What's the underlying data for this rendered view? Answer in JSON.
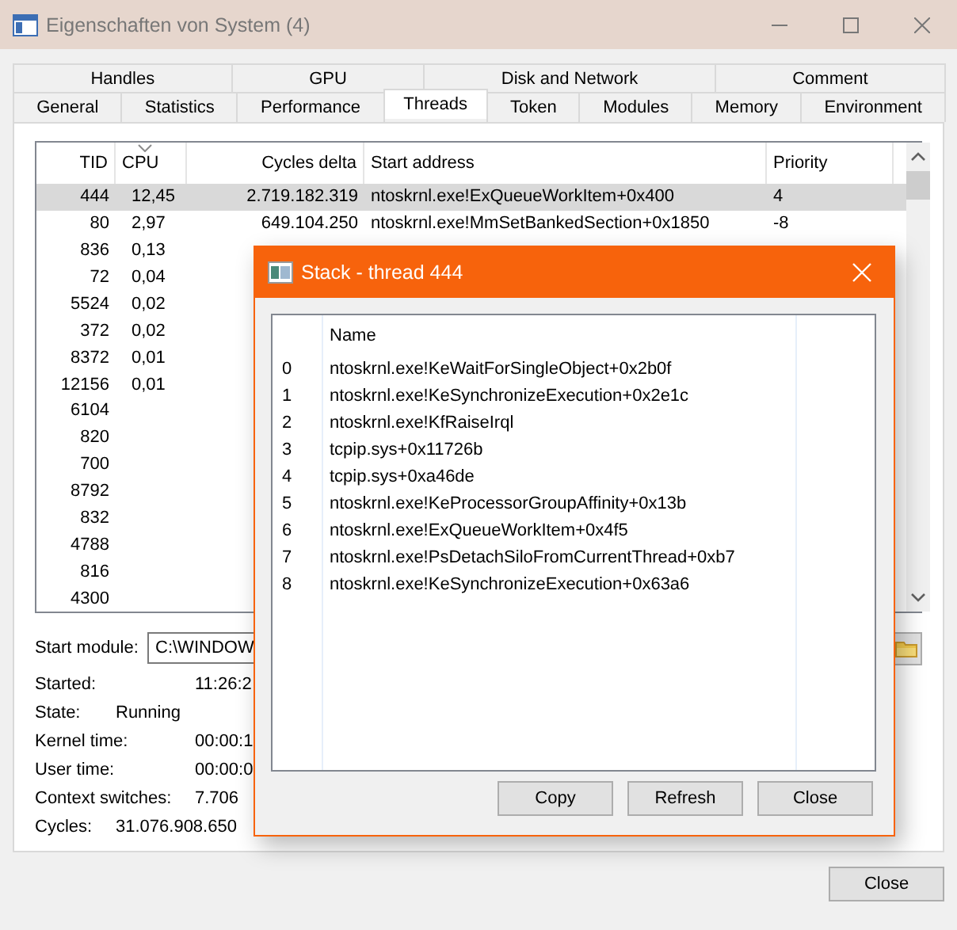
{
  "window": {
    "title": "Eigenschaften von System (4)"
  },
  "tab_rows": [
    {
      "tabs": [
        {
          "label": "Handles",
          "selected": false
        },
        {
          "label": "GPU",
          "selected": false
        },
        {
          "label": "Disk and Network",
          "selected": false
        },
        {
          "label": "Comment",
          "selected": false
        }
      ]
    },
    {
      "tabs": [
        {
          "label": "General",
          "selected": false
        },
        {
          "label": "Statistics",
          "selected": false
        },
        {
          "label": "Performance",
          "selected": false
        },
        {
          "label": "Threads",
          "selected": true
        },
        {
          "label": "Token",
          "selected": false
        },
        {
          "label": "Modules",
          "selected": false
        },
        {
          "label": "Memory",
          "selected": false
        },
        {
          "label": "Environment",
          "selected": false
        }
      ]
    }
  ],
  "threads_table": {
    "columns": [
      {
        "label": "TID",
        "sorted": false
      },
      {
        "label": "CPU",
        "sorted": true
      },
      {
        "label": "Cycles delta",
        "sorted": false
      },
      {
        "label": "Start address",
        "sorted": false
      },
      {
        "label": "Priority",
        "sorted": false
      }
    ],
    "rows": [
      {
        "cells": [
          "444",
          "12,45",
          "2.719.182.319",
          "ntoskrnl.exe!ExQueueWorkItem+0x400",
          "4"
        ],
        "selected": true
      },
      {
        "cells": [
          "80",
          "2,97",
          "649.104.250",
          "ntoskrnl.exe!MmSetBankedSection+0x1850",
          "-8"
        ],
        "selected": false
      },
      {
        "cells": [
          "836",
          "0,13"
        ],
        "selected": false
      },
      {
        "cells": [
          "72",
          "0,04"
        ],
        "selected": false
      },
      {
        "cells": [
          "5524",
          "0,02"
        ],
        "selected": false
      },
      {
        "cells": [
          "372",
          "0,02"
        ],
        "selected": false
      },
      {
        "cells": [
          "8372",
          "0,01"
        ],
        "selected": false
      },
      {
        "cells": [
          "12156",
          "0,01"
        ],
        "selected": false
      },
      {
        "cells": [
          "6104"
        ],
        "selected": false
      },
      {
        "cells": [
          "820"
        ],
        "selected": false
      },
      {
        "cells": [
          "700"
        ],
        "selected": false
      },
      {
        "cells": [
          "8792"
        ],
        "selected": false
      },
      {
        "cells": [
          "832"
        ],
        "selected": false
      },
      {
        "cells": [
          "4788"
        ],
        "selected": false
      },
      {
        "cells": [
          "816"
        ],
        "selected": false
      },
      {
        "cells": [
          "4300"
        ],
        "selected": false
      }
    ]
  },
  "start_module": {
    "label": "Start module:",
    "value": "C:\\WINDOW"
  },
  "details": [
    {
      "label": "Started:",
      "value": "11:26:2",
      "kind": "long"
    },
    {
      "label": "State:",
      "value": "Running",
      "kind": "short"
    },
    {
      "label": "Kernel time:",
      "value": "00:00:1",
      "kind": "long"
    },
    {
      "label": "User time:",
      "value": "00:00:0",
      "kind": "long"
    },
    {
      "label": "Context switches:",
      "value": "7.706",
      "kind": "long"
    },
    {
      "label": "Cycles:",
      "value": "31.076.908.650",
      "kind": "short"
    }
  ],
  "buttons": [
    {
      "label": "Close"
    }
  ],
  "stack_dialog": {
    "title": "Stack - thread 444",
    "name_header": "Name",
    "frames": [
      {
        "index": "0",
        "name": "ntoskrnl.exe!KeWaitForSingleObject+0x2b0f"
      },
      {
        "index": "1",
        "name": "ntoskrnl.exe!KeSynchronizeExecution+0x2e1c"
      },
      {
        "index": "2",
        "name": "ntoskrnl.exe!KfRaiseIrql"
      },
      {
        "index": "3",
        "name": "tcpip.sys+0x11726b"
      },
      {
        "index": "4",
        "name": "tcpip.sys+0xa46de"
      },
      {
        "index": "5",
        "name": "ntoskrnl.exe!KeProcessorGroupAffinity+0x13b"
      },
      {
        "index": "6",
        "name": "ntoskrnl.exe!ExQueueWorkItem+0x4f5"
      },
      {
        "index": "7",
        "name": "ntoskrnl.exe!PsDetachSiloFromCurrentThread+0xb7"
      },
      {
        "index": "8",
        "name": "ntoskrnl.exe!KeSynchronizeExecution+0x63a6"
      }
    ],
    "buttons": [
      {
        "label": "Copy"
      },
      {
        "label": "Refresh"
      },
      {
        "label": "Close"
      }
    ]
  }
}
